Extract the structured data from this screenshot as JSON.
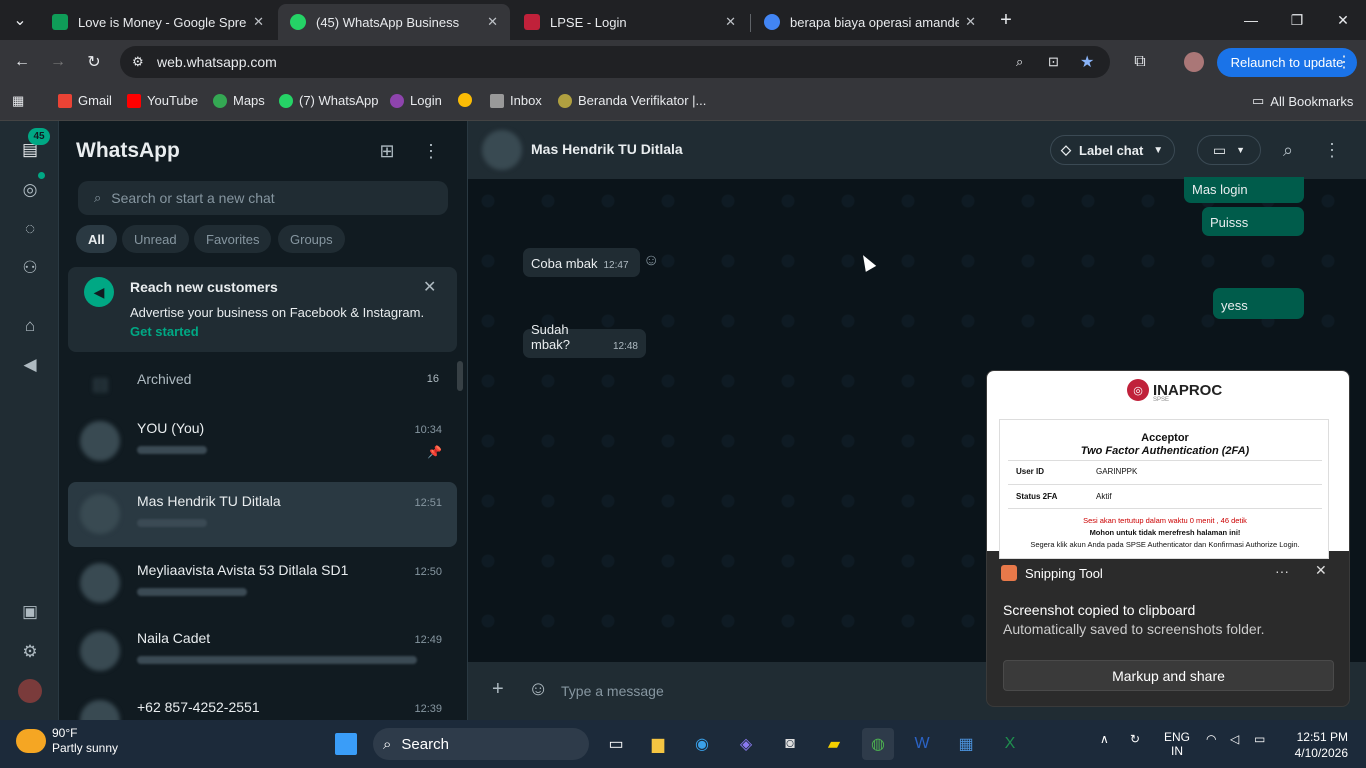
{
  "browser": {
    "tabs": [
      {
        "title": "Love is Money - Google Spread",
        "color": "#0f9d58"
      },
      {
        "title": "(45) WhatsApp Business",
        "color": "#25d366"
      },
      {
        "title": "LPSE - Login",
        "color": "#c0213a"
      },
      {
        "title": "berapa biaya operasi amandel",
        "color": "#4285f4"
      }
    ],
    "url": "web.whatsapp.com",
    "relaunch_label": "Relaunch to update",
    "bookmarks": [
      "Gmail",
      "YouTube",
      "Maps",
      "(7) WhatsApp",
      "Login",
      "Inbox",
      "Beranda Verifikator |..."
    ],
    "all_bookmarks": "All Bookmarks"
  },
  "sidebar": {
    "badge": "45",
    "title": "WhatsApp",
    "search_placeholder": "Search or start a new chat",
    "filters": [
      "All",
      "Unread",
      "Favorites",
      "Groups"
    ],
    "promo": {
      "title": "Reach new customers",
      "subtitle": "Advertise your business on Facebook & Instagram.",
      "link": "Get started"
    },
    "archived_label": "Archived",
    "archived_count": "16",
    "chats": [
      {
        "name": "YOU (You)",
        "time": "10:34"
      },
      {
        "name": "Mas Hendrik TU Ditlala",
        "time": "12:51"
      },
      {
        "name": "Meyliaavista Avista 53 Ditlala SD1",
        "time": "12:50"
      },
      {
        "name": "Naila Cadet",
        "time": "12:49"
      },
      {
        "name": "+62 857-4252-2551",
        "time": "12:39"
      }
    ]
  },
  "chat": {
    "contact": "Mas Hendrik TU Ditlala",
    "label_chat": "Label chat",
    "composer_placeholder": "Type a message",
    "messages": [
      {
        "text": "Mas login"
      },
      {
        "text": "Puisss"
      },
      {
        "text": "Coba mbak",
        "time": "12:47"
      },
      {
        "text": "yess"
      },
      {
        "text": "Sudah mbak?",
        "time": "12:48"
      }
    ]
  },
  "toast": {
    "brand": "INAPROC",
    "brand_sub": "SPSE",
    "doc_title": "Acceptor",
    "doc_subtitle": "Two Factor Authentication (2FA)",
    "user_id_label": "User ID",
    "user_id": "GARINPPK",
    "status_label": "Status 2FA",
    "status": "Aktif",
    "note1": "Sesi akan tertutup dalam waktu 0 menit , 46 detik",
    "note2": "Mohon untuk tidak merefresh halaman ini!",
    "note3": "Segera klik akun Anda pada SPSE Authenticator dan Konfirmasi Authorize Login.",
    "app": "Snipping Tool",
    "line1": "Screenshot copied to clipboard",
    "line2": "Automatically saved to screenshots folder.",
    "button": "Markup and share"
  },
  "taskbar": {
    "temp": "90°F",
    "weather": "Partly sunny",
    "search": "Search",
    "lang1": "ENG",
    "lang2": "IN",
    "time": "12:51 PM",
    "date": "4/10/2026"
  }
}
